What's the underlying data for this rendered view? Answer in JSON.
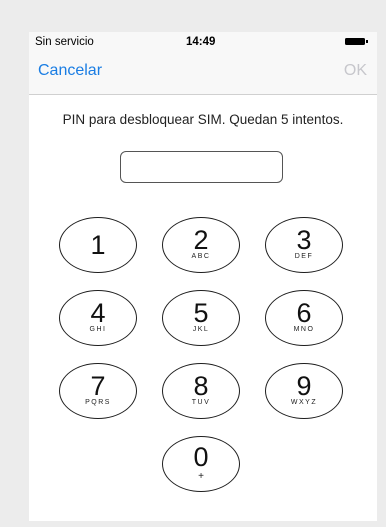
{
  "status_bar": {
    "carrier": "Sin servicio",
    "time": "14:49"
  },
  "navbar": {
    "cancel_label": "Cancelar",
    "ok_label": "OK"
  },
  "prompt": "PIN para desbloquear SIM. Quedan 5 intentos.",
  "pin_input": {
    "value": ""
  },
  "keypad": [
    {
      "digit": "1",
      "letters": ""
    },
    {
      "digit": "2",
      "letters": "ABC"
    },
    {
      "digit": "3",
      "letters": "DEF"
    },
    {
      "digit": "4",
      "letters": "GHI"
    },
    {
      "digit": "5",
      "letters": "JKL"
    },
    {
      "digit": "6",
      "letters": "MNO"
    },
    {
      "digit": "7",
      "letters": "PQRS"
    },
    {
      "digit": "8",
      "letters": "TUV"
    },
    {
      "digit": "9",
      "letters": "WXYZ"
    },
    {
      "digit": "0",
      "letters": "+"
    }
  ],
  "colors": {
    "accent": "#1a7de3",
    "disabled": "#c7c7cc"
  }
}
